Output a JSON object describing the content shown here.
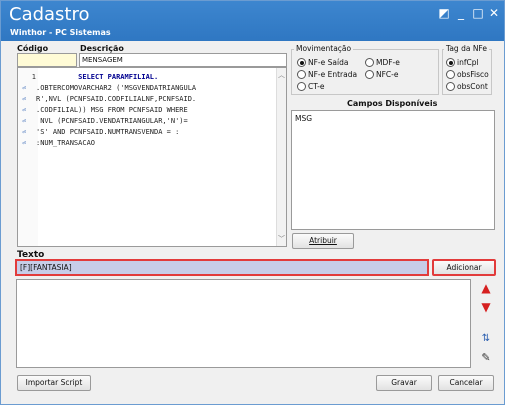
{
  "window": {
    "title": "Cadastro",
    "subtitle": "Winthor - PC Sistemas",
    "controls": {
      "restore_icon": "◩",
      "minimize_icon": "_",
      "maximize_icon": "□",
      "close_icon": "✕"
    }
  },
  "fields": {
    "codigo_label": "Código",
    "codigo_value": "",
    "descricao_label": "Descrição",
    "descricao_value": "MENSAGEM"
  },
  "editor": {
    "line_number": "1",
    "lines": [
      "SELECT PARAMFILIAL.",
      ".OBTERCOMOVARCHAR2 ('MSGVENDATRIANGULA",
      "R',NVL (PCNFSAID.CODFILIALNF,PCNFSAID.",
      ".CODFILIAL)) MSG FROM PCNFSAID WHERE",
      " NVL (PCNFSAID.VENDATRIANGULAR,'N')=",
      "'S' AND PCNFSAID.NUMTRANSVENDA = :",
      ":NUM_TRANSACAO"
    ]
  },
  "movimentacao": {
    "title": "Movimentação",
    "options": [
      {
        "label": "NF-e Saída",
        "selected": true
      },
      {
        "label": "MDF-e",
        "selected": false
      },
      {
        "label": "NF-e Entrada",
        "selected": false
      },
      {
        "label": "NFC-e",
        "selected": false
      },
      {
        "label": "CT-e",
        "selected": false
      }
    ]
  },
  "tag_nfe": {
    "title": "Tag da NFe",
    "options": [
      {
        "label": "infCpl",
        "selected": true
      },
      {
        "label": "obsFisco",
        "selected": false
      },
      {
        "label": "obsCont",
        "selected": false
      }
    ]
  },
  "campos": {
    "title": "Campos Disponíveis",
    "items": [
      "MSG"
    ],
    "atribuir_label": "Atribuir"
  },
  "texto": {
    "label": "Texto",
    "value": "[F][FANTASIA]",
    "adicionar_label": "Adicionar"
  },
  "footer": {
    "importar_label": "Importar Script",
    "gravar_label": "Gravar",
    "cancelar_label": "Cancelar"
  }
}
